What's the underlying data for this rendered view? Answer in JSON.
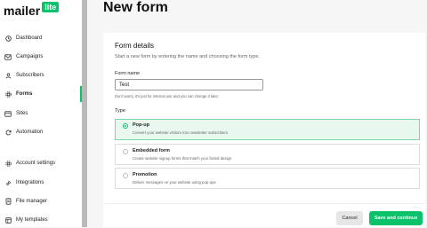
{
  "app": {
    "brand_name": "mailer",
    "brand_badge": "lite",
    "brand_color": "#09c269"
  },
  "sidebar": {
    "items": [
      {
        "label": "Dashboard",
        "icon": "clock-icon",
        "active": false
      },
      {
        "label": "Campaigns",
        "icon": "mail-icon",
        "active": false
      },
      {
        "label": "Subscribers",
        "icon": "user-icon",
        "active": false
      },
      {
        "label": "Forms",
        "icon": "gear-icon",
        "active": true
      },
      {
        "label": "Sites",
        "icon": "sites-icon",
        "active": false
      },
      {
        "label": "Automation",
        "icon": "refresh-icon",
        "active": false
      },
      {
        "label": "Account settings",
        "icon": "settings-icon",
        "active": false
      },
      {
        "label": "Integrations",
        "icon": "link-icon",
        "active": false
      },
      {
        "label": "File manager",
        "icon": "file-icon",
        "active": false
      },
      {
        "label": "My templates",
        "icon": "template-icon",
        "active": false
      }
    ]
  },
  "page": {
    "title": "New form"
  },
  "form_details": {
    "title": "Form details",
    "subtitle": "Start a new form by entering the name and choosing the form type.",
    "name_label": "Form name",
    "name_value": "Test",
    "name_helper": "Don't worry, it's just for internal use and you can change it later.",
    "type_label": "Type",
    "types": [
      {
        "title": "Pop-up",
        "description": "Convert your website visitors into newsletter subscribers",
        "selected": true
      },
      {
        "title": "Embedded form",
        "description": "Create website signup forms that match your brand design",
        "selected": false
      },
      {
        "title": "Promotion",
        "description": "Deliver messages on your website using pop-ups",
        "selected": false
      }
    ]
  },
  "actions": {
    "cancel_label": "Cancel",
    "primary_label": "Save and continue"
  }
}
